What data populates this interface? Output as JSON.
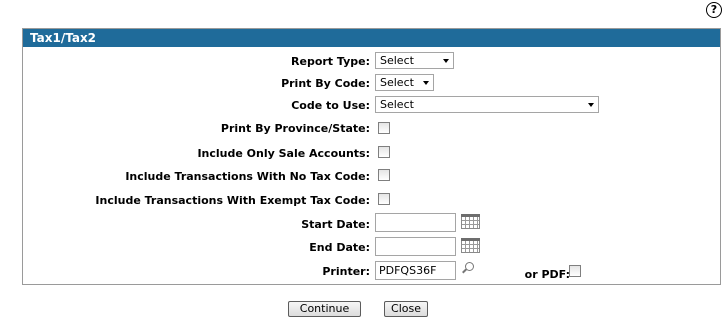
{
  "help": {
    "glyph": "?"
  },
  "panel": {
    "title": "Tax1/Tax2"
  },
  "form": {
    "report_type": {
      "label": "Report Type:",
      "value": "Select"
    },
    "print_by_code": {
      "label": "Print By Code:",
      "value": "Select"
    },
    "code_to_use": {
      "label": "Code to Use:",
      "value": "Select"
    },
    "print_by_province": {
      "label": "Print By Province/State:",
      "checked": false
    },
    "include_sale_accounts": {
      "label": "Include Only Sale Accounts:",
      "checked": false
    },
    "include_no_tax_code": {
      "label": "Include Transactions With No Tax Code:",
      "checked": false
    },
    "include_exempt_tax_code": {
      "label": "Include Transactions With Exempt Tax Code:",
      "checked": false
    },
    "start_date": {
      "label": "Start Date:",
      "value": ""
    },
    "end_date": {
      "label": "End Date:",
      "value": ""
    },
    "printer": {
      "label": "Printer:",
      "value": "PDFQS36F"
    },
    "or_pdf": {
      "label": "or PDF:",
      "checked": false
    }
  },
  "buttons": {
    "continue": "Continue",
    "close": "Close"
  }
}
